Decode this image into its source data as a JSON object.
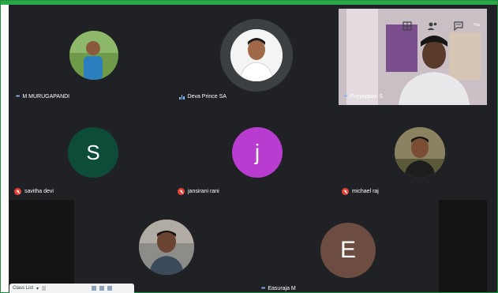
{
  "participants": [
    {
      "name": "M MURUGAPANDI",
      "status": "speaking-dots"
    },
    {
      "name": "Deva Prince SA",
      "status": "speaking-wave"
    },
    {
      "name": "Poyyappan S",
      "status": "speaking-dots"
    },
    {
      "name": "savitha devi",
      "status": "muted",
      "initial": "S",
      "avatar_color": "#0e4c3a"
    },
    {
      "name": "jansirani rani",
      "status": "muted",
      "initial": "j",
      "avatar_color": "#b73ccf"
    },
    {
      "name": "michael raj",
      "status": "muted"
    },
    {
      "name": "",
      "status": "none"
    },
    {
      "name": "Easuraja M",
      "status": "speaking-dots",
      "initial": "E",
      "avatar_color": "#6d4c41"
    }
  ],
  "self_view": {
    "label": "You"
  },
  "class_list": {
    "label": "Class List"
  },
  "colors": {
    "frame_border": "#1e8f3a",
    "stage_bg": "#202124",
    "muted_red": "#ea4335",
    "accent_blue": "#8ab4f8"
  },
  "icons": [
    "grid-icon",
    "people-icon",
    "chat-icon",
    "mic-off-icon",
    "audio-wave-icon"
  ]
}
